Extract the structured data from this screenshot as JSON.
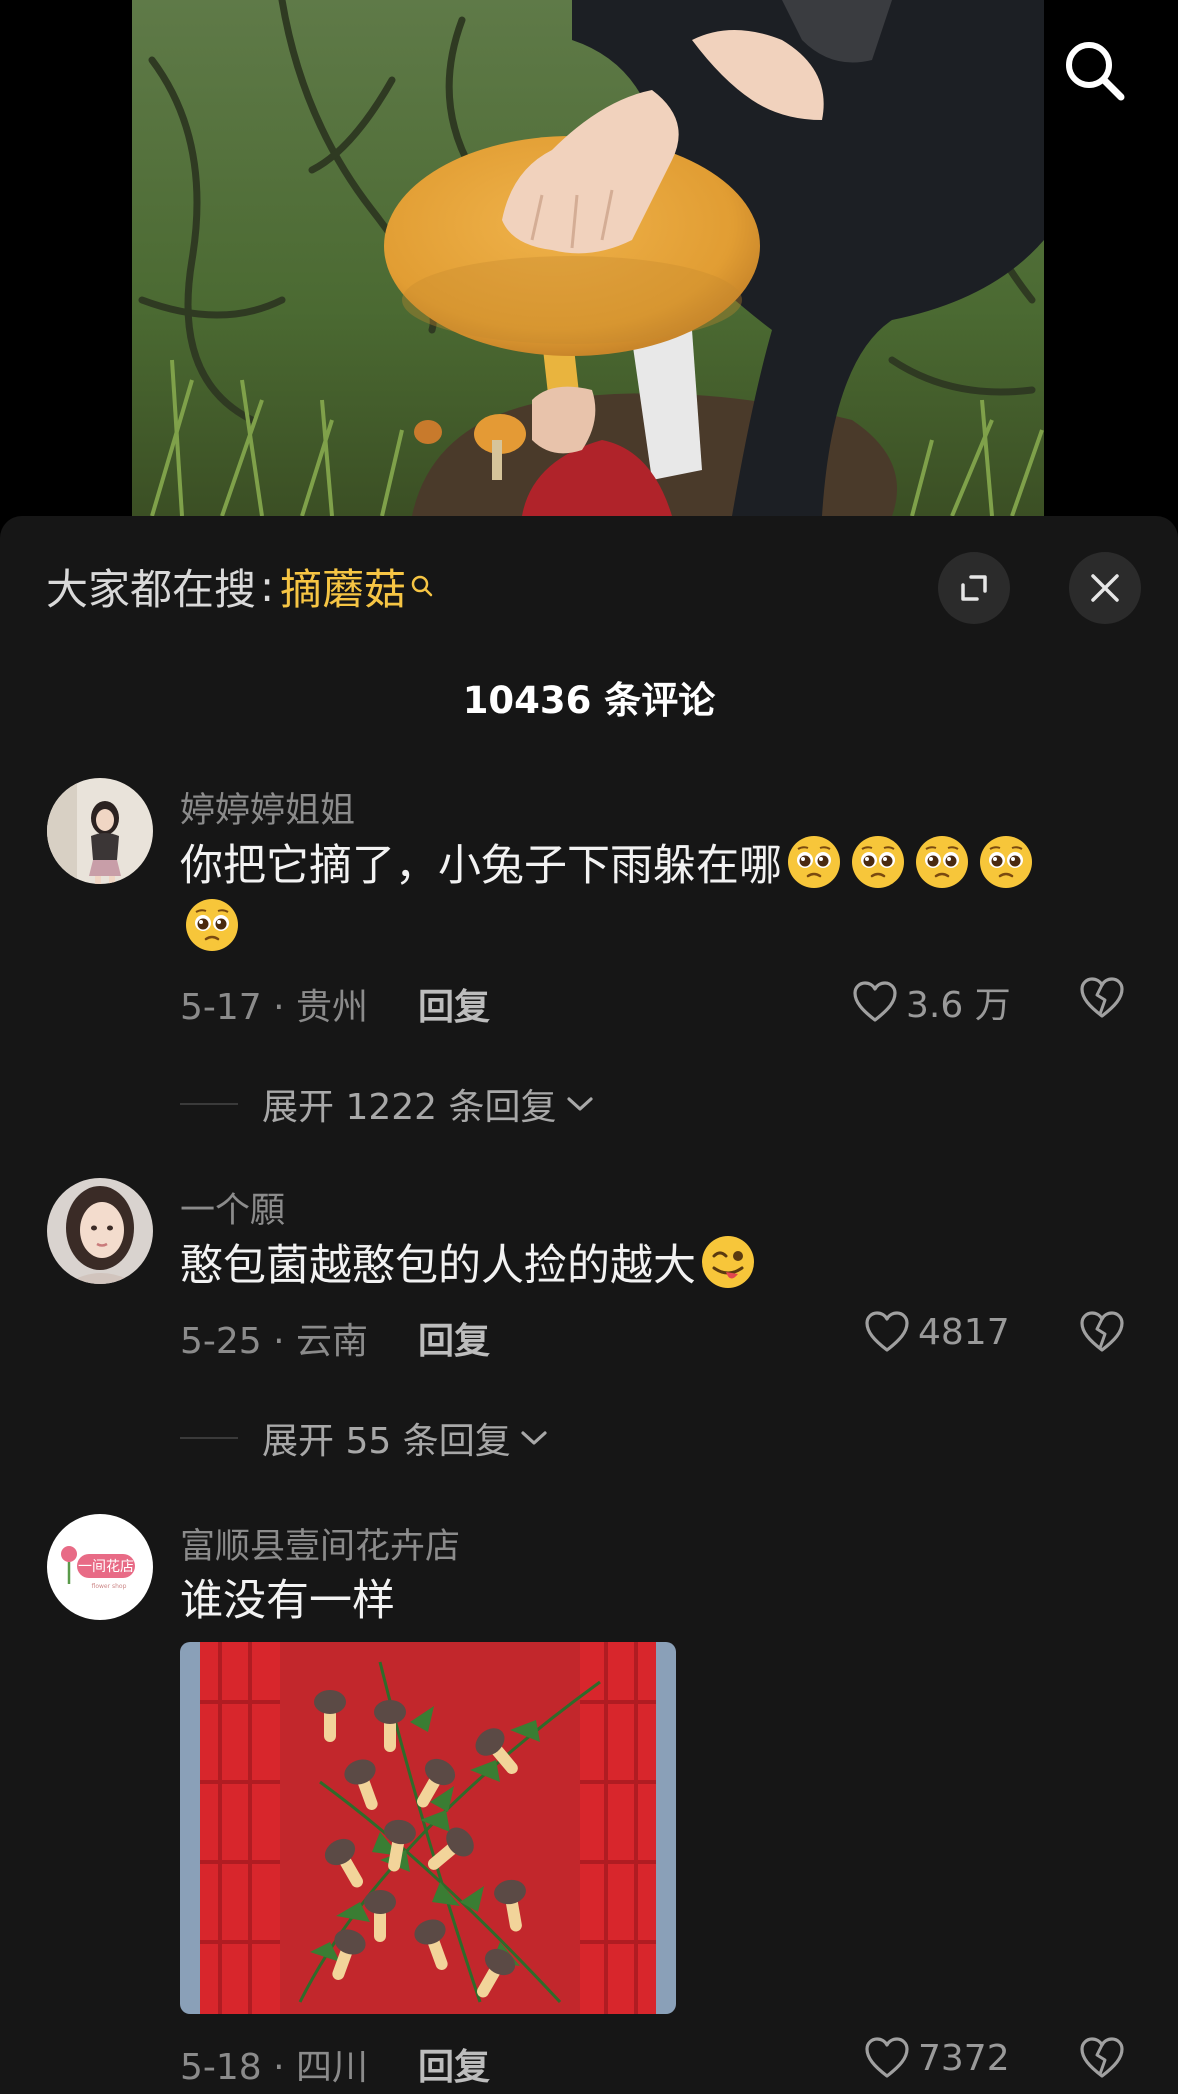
{
  "panel": {
    "trending_prefix": "大家都在搜",
    "trending_colon": ":",
    "trending_keyword": "摘蘑菇",
    "comment_count": "10436 条评论"
  },
  "comments": [
    {
      "user": "婷婷婷姐姐",
      "text": "你把它摘了，小兔子下雨躲在哪",
      "emoji": "pleading-face",
      "emoji_count": 5,
      "date_loc": "5-17 · 贵州",
      "reply_label": "回复",
      "likes": "3.6 万",
      "expand_label": "展开 1222 条回复"
    },
    {
      "user": "一个願",
      "text": "憨包菌越憨包的人捡的越大",
      "emoji": "winking-tongue-face",
      "date_loc": "5-25 · 云南",
      "reply_label": "回复",
      "likes": "4817",
      "expand_label": "展开 55 条回复"
    },
    {
      "user": "富顺县壹间花卉店",
      "text": "谁没有一样",
      "avatar_logo_text": "一间花店",
      "has_image": true,
      "image_subject": "mushroom-shaped cookies on fern leaves in a red basket",
      "date_loc": "5-18 · 四川",
      "reply_label": "回复",
      "likes": "7372"
    }
  ],
  "colors": {
    "panel_bg": "#161616",
    "keyword": "#f6c544",
    "muted": "#8b8b8b",
    "button_bg": "#2b2b2b"
  },
  "icons": [
    "search-icon",
    "search-small-icon",
    "expand-icon",
    "close-icon",
    "heart-icon",
    "broken-heart-icon",
    "chevron-down-icon"
  ]
}
